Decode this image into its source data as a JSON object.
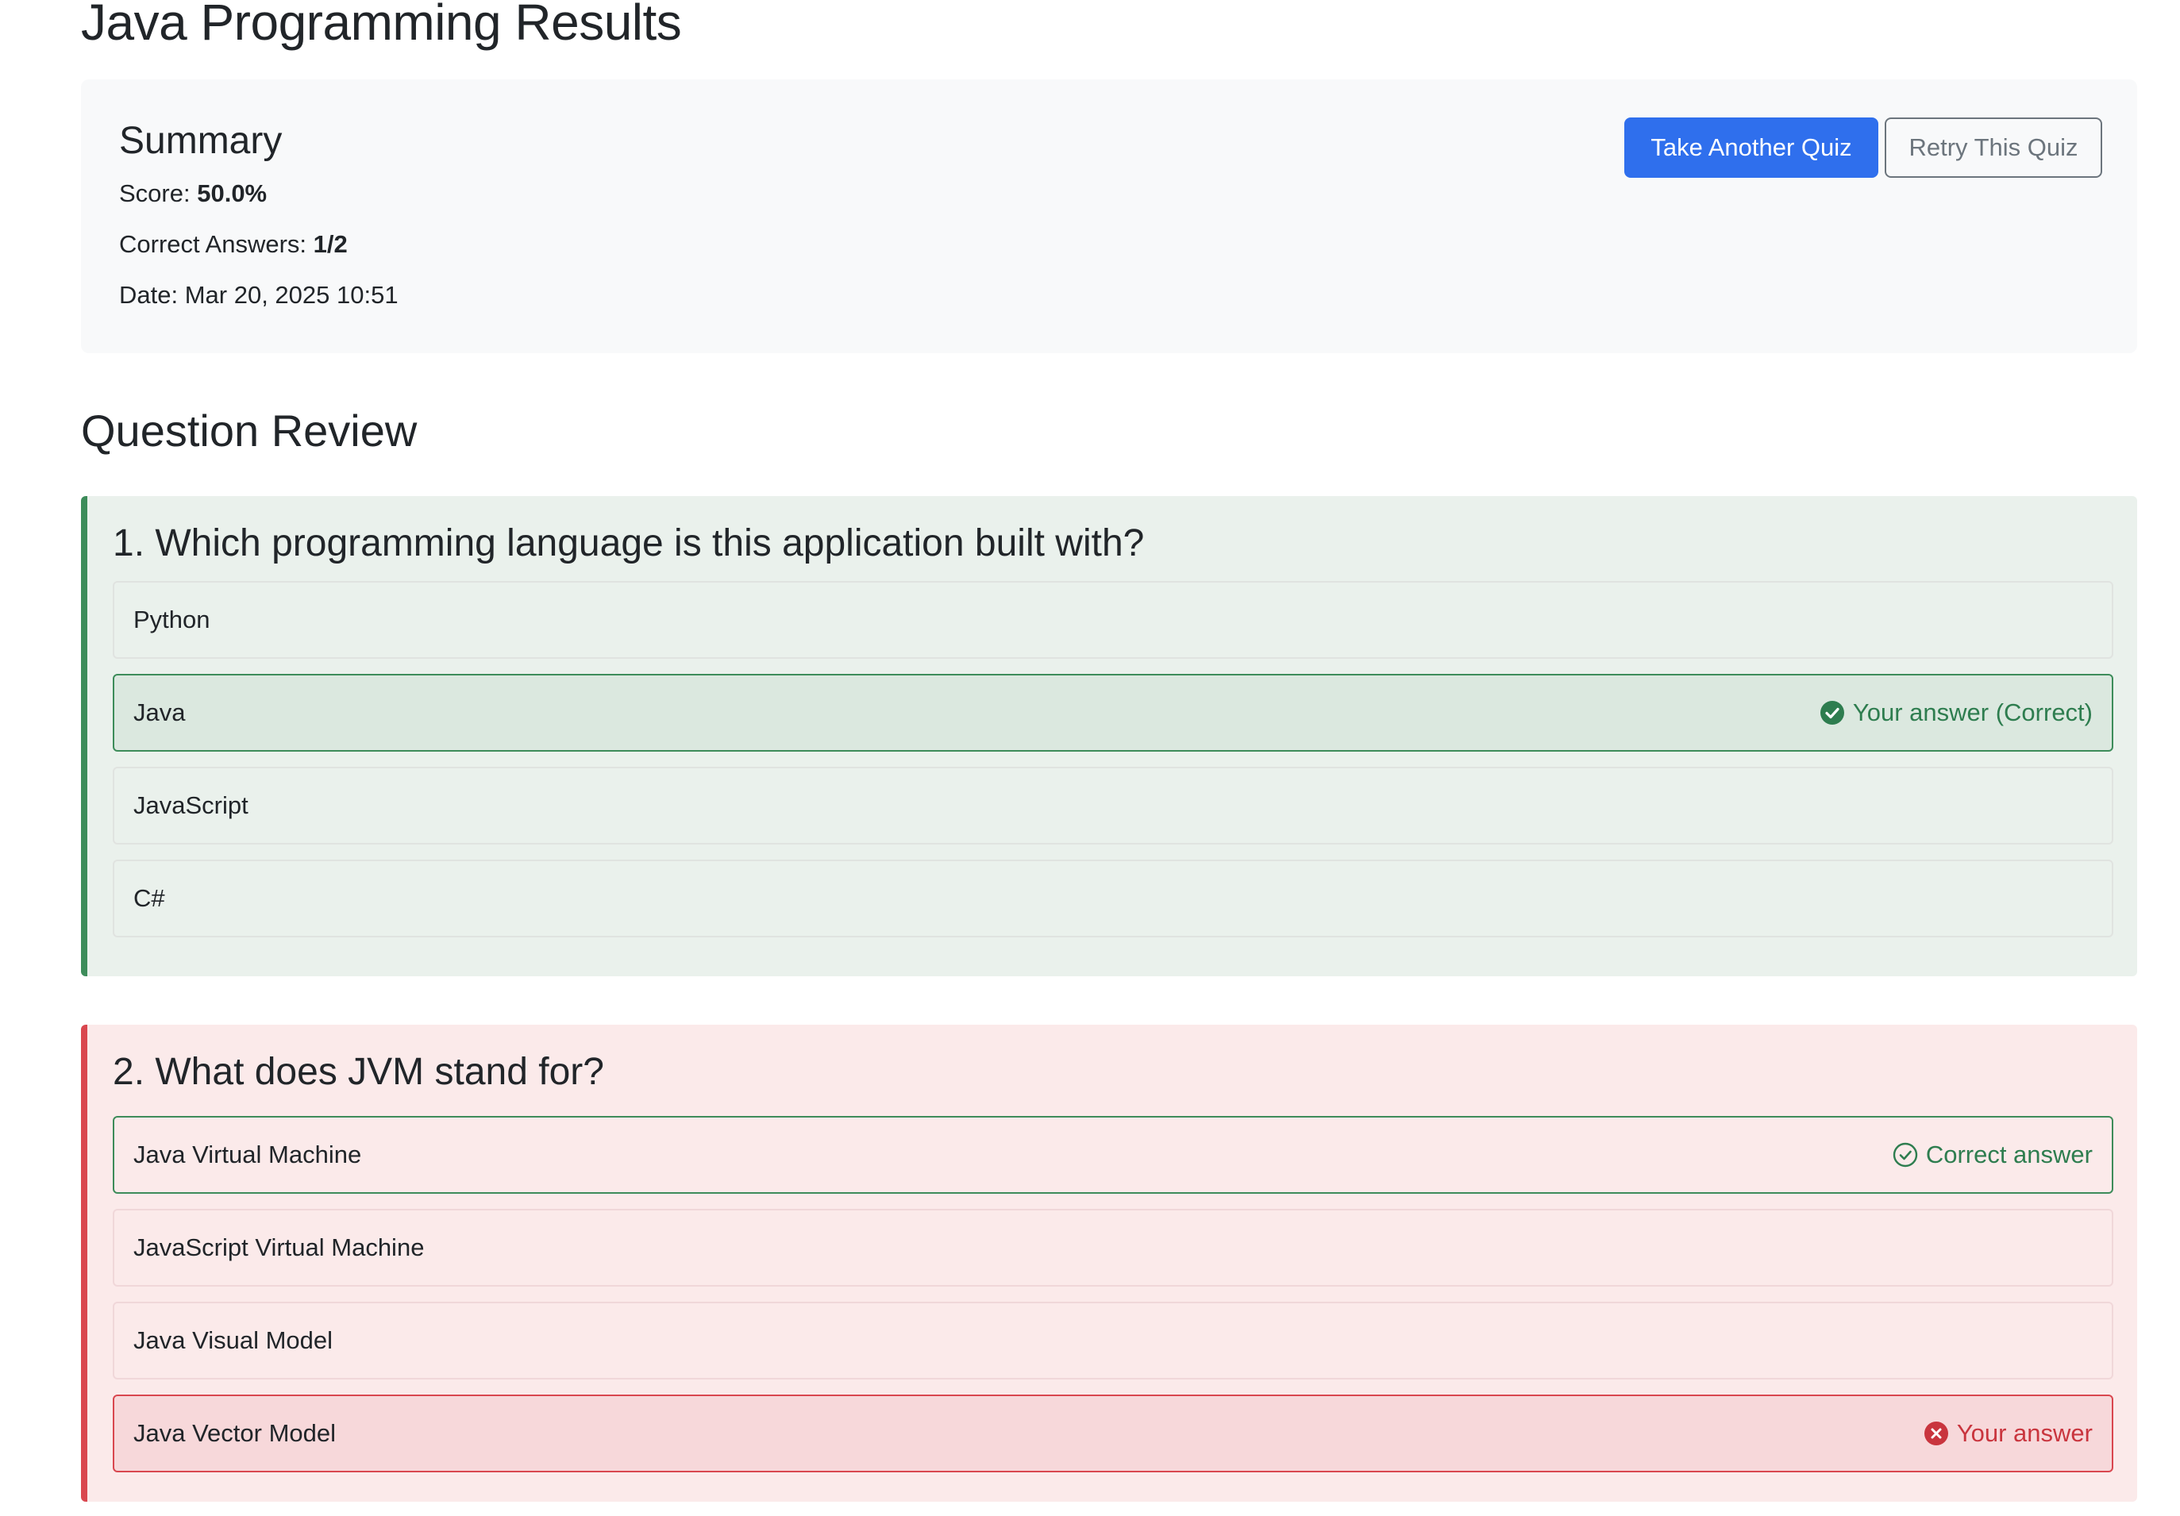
{
  "page": {
    "title": "Java Programming Results"
  },
  "summary": {
    "heading": "Summary",
    "score_label": "Score: ",
    "score_value": "50.0%",
    "correct_label": "Correct Answers: ",
    "correct_value": "1/2",
    "date_label": "Date: ",
    "date_value": "Mar 20, 2025 10:51",
    "take_another_label": "Take Another Quiz",
    "retry_label": "Retry This Quiz"
  },
  "review": {
    "heading": "Question Review",
    "questions": [
      {
        "text": "1. Which programming language is this application built with?",
        "result": "correct",
        "options": [
          {
            "label": "Python",
            "status": ""
          },
          {
            "label": "Java",
            "status": "Your answer (Correct)",
            "status_icon": "check-circle-filled-icon"
          },
          {
            "label": "JavaScript",
            "status": ""
          },
          {
            "label": "C#",
            "status": ""
          }
        ]
      },
      {
        "text": "2. What does JVM stand for?",
        "result": "incorrect",
        "options": [
          {
            "label": "Java Virtual Machine",
            "status": "Correct answer",
            "status_icon": "check-circle-outline-icon"
          },
          {
            "label": "JavaScript Virtual Machine",
            "status": ""
          },
          {
            "label": "Java Visual Model",
            "status": ""
          },
          {
            "label": "Java Vector Model",
            "status": "Your answer",
            "status_icon": "x-circle-filled-icon"
          }
        ]
      }
    ]
  },
  "colors": {
    "primary": "#2f6fed",
    "secondary": "#6c757d",
    "success": "#2e7d4f",
    "danger": "#c9353e",
    "correct_bg": "#eaf1ec",
    "incorrect_bg": "#fbeaea"
  }
}
